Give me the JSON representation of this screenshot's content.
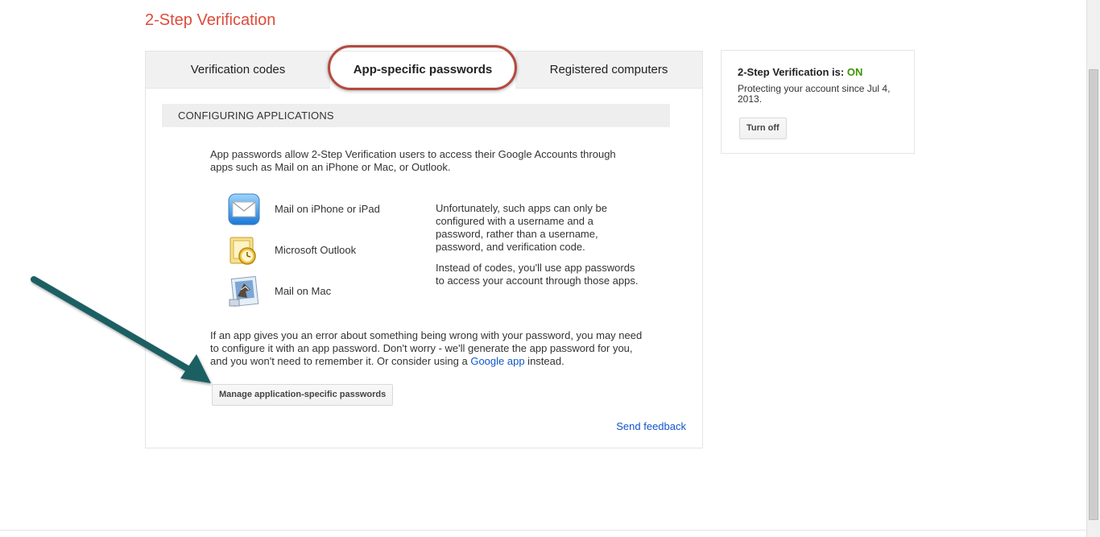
{
  "page": {
    "title": "2-Step Verification"
  },
  "tabs": [
    {
      "label": "Verification codes"
    },
    {
      "label": "App-specific passwords"
    },
    {
      "label": "Registered computers"
    }
  ],
  "section": {
    "header": "CONFIGURING APPLICATIONS",
    "intro": "App passwords allow 2-Step Verification users to access their Google Accounts through apps such as Mail on an iPhone or Mac, or Outlook.",
    "apps": [
      {
        "label": "Mail on iPhone or iPad",
        "icon": "iphone-mail-icon"
      },
      {
        "label": "Microsoft Outlook",
        "icon": "outlook-icon"
      },
      {
        "label": "Mail on Mac",
        "icon": "mac-mail-icon"
      }
    ],
    "side_para_1": "Unfortunately, such apps can only be configured with a username and a password, rather than a username, password, and verification code.",
    "side_para_2": "Instead of codes, you'll use app passwords to access your account through those apps.",
    "error_text_before": "If an app gives you an error about something being wrong with your password, you may need to configure it with an app password. Don't worry - we'll generate the app password for you, and you won't need to remember it. Or consider using a ",
    "error_link": "Google app",
    "error_text_after": " instead.",
    "manage_button": "Manage application-specific passwords",
    "feedback_link": "Send feedback"
  },
  "status": {
    "label": "2-Step Verification is: ",
    "value": "ON",
    "description": "Protecting your account since Jul 4, 2013.",
    "turn_off_button": "Turn off"
  },
  "colors": {
    "title_red": "#dd4b39",
    "link_blue": "#1155cc",
    "on_green": "#3d9400",
    "arrow_teal": "#1e5f63",
    "highlight_ring": "#b34a3e"
  }
}
